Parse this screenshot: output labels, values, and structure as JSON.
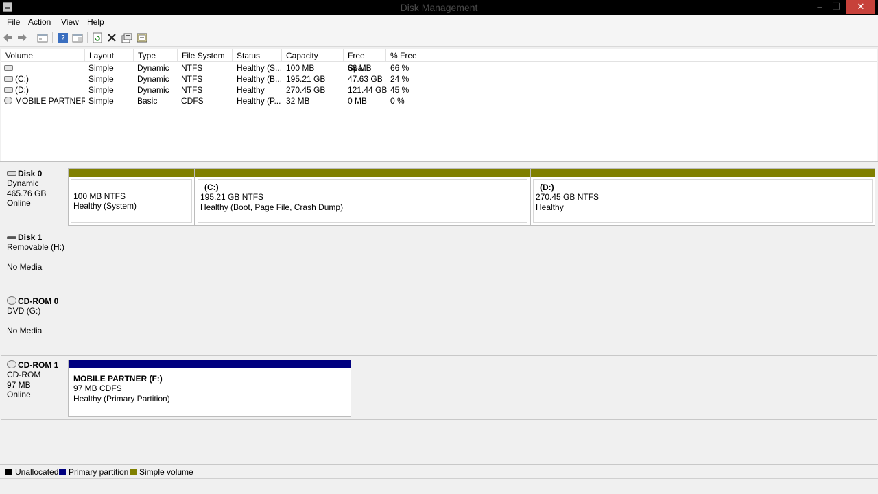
{
  "window": {
    "title": "Disk Management",
    "minimize": "–",
    "restore": "❐",
    "close": "✕"
  },
  "menu": [
    "File",
    "Action",
    "View",
    "Help"
  ],
  "toolbar_icons": [
    "back-arrow-icon",
    "forward-arrow-icon",
    "console-tree-icon",
    "help-icon",
    "properties-pane-icon",
    "refresh-icon",
    "delete-icon",
    "properties-icon",
    "disk-settings-icon"
  ],
  "volume_list": {
    "columns": [
      "Volume",
      "Layout",
      "Type",
      "File System",
      "Status",
      "Capacity",
      "Free Spa...",
      "% Free"
    ],
    "rows": [
      {
        "icon": "volume-icon",
        "volume": "",
        "layout": "Simple",
        "type": "Dynamic",
        "fs": "NTFS",
        "status": "Healthy (S...",
        "capacity": "100 MB",
        "free": "66 MB",
        "pct": "66 %"
      },
      {
        "icon": "volume-icon",
        "volume": "(C:)",
        "layout": "Simple",
        "type": "Dynamic",
        "fs": "NTFS",
        "status": "Healthy (B...",
        "capacity": "195.21 GB",
        "free": "47.63 GB",
        "pct": "24 %"
      },
      {
        "icon": "volume-icon",
        "volume": "(D:)",
        "layout": "Simple",
        "type": "Dynamic",
        "fs": "NTFS",
        "status": "Healthy",
        "capacity": "270.45 GB",
        "free": "121.44 GB",
        "pct": "45 %"
      },
      {
        "icon": "cdrom-volume-icon",
        "volume": "MOBILE PARTNER...",
        "layout": "Simple",
        "type": "Basic",
        "fs": "CDFS",
        "status": "Healthy (P...",
        "capacity": "32 MB",
        "free": "0 MB",
        "pct": "0 %"
      }
    ]
  },
  "disks": [
    {
      "name": "Disk 0",
      "line1": "Dynamic",
      "line2": "465.76 GB",
      "line3": "Online",
      "partitions": [
        {
          "title": "",
          "fs": "100 MB NTFS",
          "status": "Healthy (System)"
        },
        {
          "title": "(C:)",
          "fs": "195.21 GB NTFS",
          "status": "Healthy (Boot, Page File, Crash Dump)"
        },
        {
          "title": "(D:)",
          "fs": "270.45 GB NTFS",
          "status": "Healthy"
        }
      ]
    },
    {
      "name": "Disk 1",
      "line1": "Removable (H:)",
      "line2": "",
      "line3": "No Media"
    },
    {
      "name": "CD-ROM 0",
      "line1": "DVD (G:)",
      "line2": "",
      "line3": "No Media"
    },
    {
      "name": "CD-ROM 1",
      "line1": "CD-ROM",
      "line2": "97 MB",
      "line3": "Online",
      "partitions": [
        {
          "title": "MOBILE PARTNER  (F:)",
          "fs": "97 MB CDFS",
          "status": "Healthy (Primary Partition)"
        }
      ]
    }
  ],
  "legend": [
    {
      "label": "Unallocated",
      "color": "#000000"
    },
    {
      "label": "Primary partition",
      "color": "#000080"
    },
    {
      "label": "Simple volume",
      "color": "#808000"
    }
  ]
}
